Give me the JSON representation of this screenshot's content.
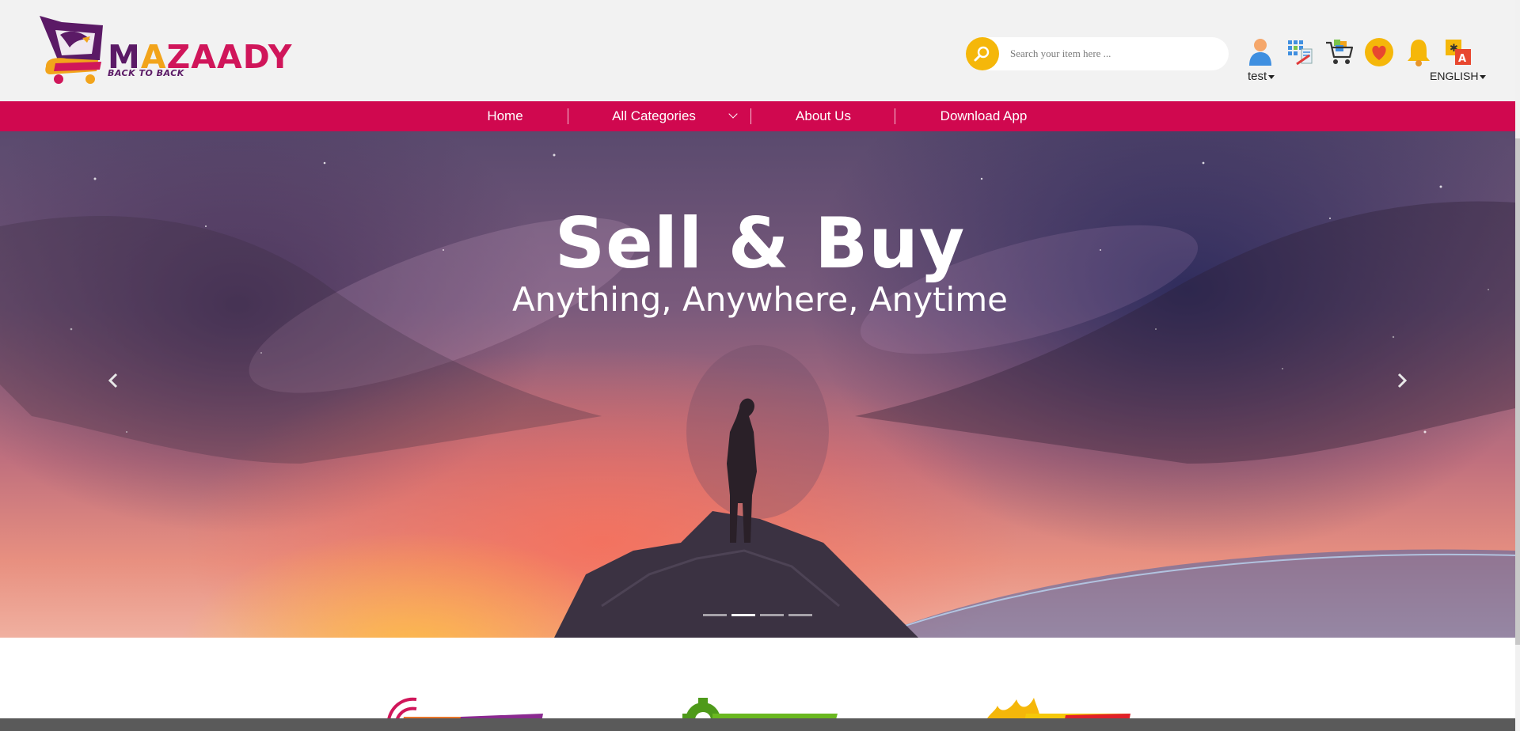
{
  "header": {
    "logo": {
      "name": "MAZAADY",
      "part1": "M",
      "part2": "A",
      "part3": "ZAADY",
      "tagline": "BACK TO BACK"
    },
    "search": {
      "placeholder": "Search your item here ...",
      "icon": "search-icon",
      "accent": "#f5b70a"
    },
    "user": {
      "label": "test",
      "icon": "user-icon"
    },
    "icons": [
      "user-icon",
      "calculator-icon",
      "cart-icon",
      "heart-icon",
      "bell-icon",
      "translate-icon"
    ],
    "language": {
      "label": "ENGLISH"
    }
  },
  "nav": {
    "color": "#d0084f",
    "items": [
      {
        "label": "Home"
      },
      {
        "label": "All Categories"
      },
      {
        "label": "About Us"
      },
      {
        "label": "Download App"
      }
    ]
  },
  "hero": {
    "title": "Sell & Buy",
    "subtitle": "Anything, Anywhere, Anytime",
    "slide_count": 4,
    "active_slide": 2
  },
  "badges": [
    "live-auction-badge",
    "settings-badge",
    "hot-deal-badge"
  ]
}
